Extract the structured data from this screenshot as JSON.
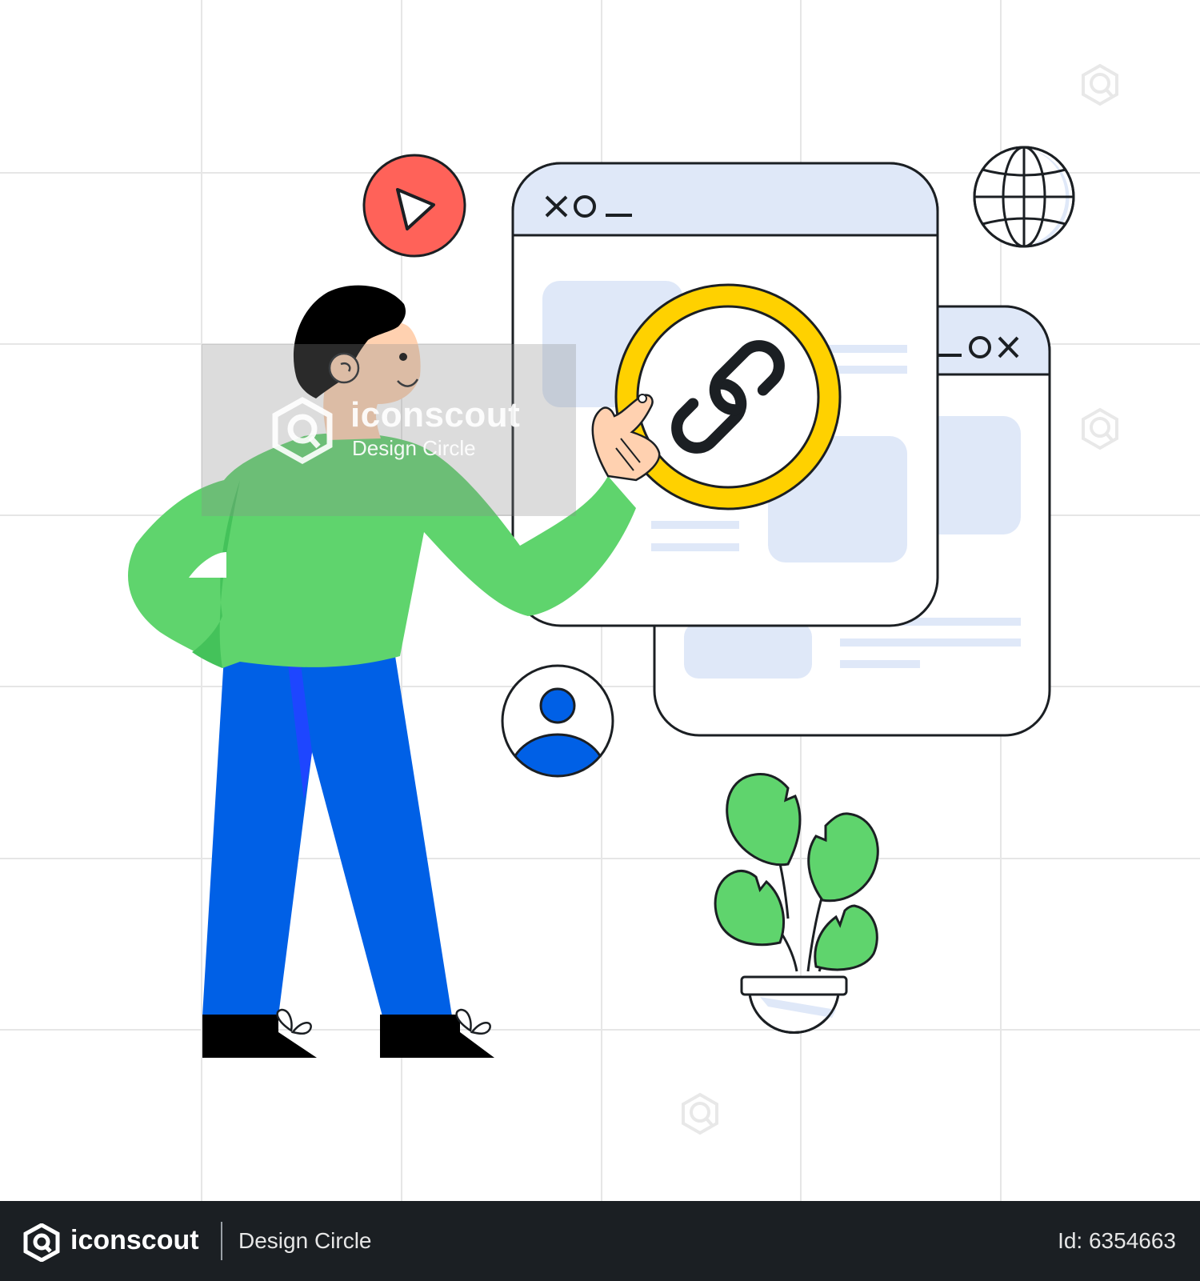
{
  "watermark": {
    "brand": "iconscout",
    "subtitle": "Design Circle"
  },
  "footer": {
    "brand": "iconscout",
    "subtitle": "Design Circle",
    "asset_id": "Id: 6354663"
  },
  "colors": {
    "shirt": "#5fd46d",
    "pants": "#0060e6",
    "link_ring": "#ffd100",
    "play_button": "#ff6259",
    "window_fill": "#dfe8f8",
    "footer_bg": "#1b1f23"
  },
  "icons": [
    "play-icon",
    "globe-icon",
    "link-icon",
    "user-avatar-icon",
    "search-watermark-icon",
    "plant-illustration",
    "person-illustration"
  ]
}
